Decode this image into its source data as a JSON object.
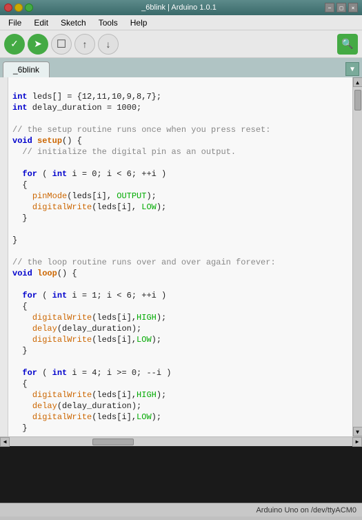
{
  "titleBar": {
    "title": "_6blink | Arduino 1.0.1",
    "closeIcon": "×",
    "minIcon": "−",
    "maxIcon": "□"
  },
  "menuBar": {
    "items": [
      "File",
      "Edit",
      "Sketch",
      "Tools",
      "Help"
    ]
  },
  "toolbar": {
    "checkLabel": "✓",
    "uploadLabel": "→",
    "newLabel": "□",
    "openLabel": "↑",
    "saveLabel": "↓",
    "searchLabel": "🔍"
  },
  "tabs": {
    "activeTab": "_6blink",
    "dropdownIcon": "▼"
  },
  "editor": {
    "code": "int leds[] = {12,11,10,9,8,7};\nint delay_duration = 1000;\n\n// the setup routine runs once when you press reset:\nvoid setup() {\n  // initialize the digital pin as an output.\n\n  for ( int i = 0; i < 6; ++i )\n  {\n    pinMode(leds[i], OUTPUT);\n    digitalWrite(leds[i], LOW);\n  }\n\n}\n\n// the loop routine runs over and over again forever:\nvoid loop() {\n\n  for ( int i = 1; i < 6; ++i )\n  {\n    digitalWrite(leds[i],HIGH);\n    delay(delay_duration);\n    digitalWrite(leds[i],LOW);\n  }\n\n  for ( int i = 4; i >= 0; --i )\n  {\n    digitalWrite(leds[i],HIGH);\n    delay(delay_duration);\n    digitalWrite(leds[i],LOW);\n  }\n\n}"
  },
  "statusBar": {
    "text": "Arduino Uno on /dev/ttyACM0"
  }
}
